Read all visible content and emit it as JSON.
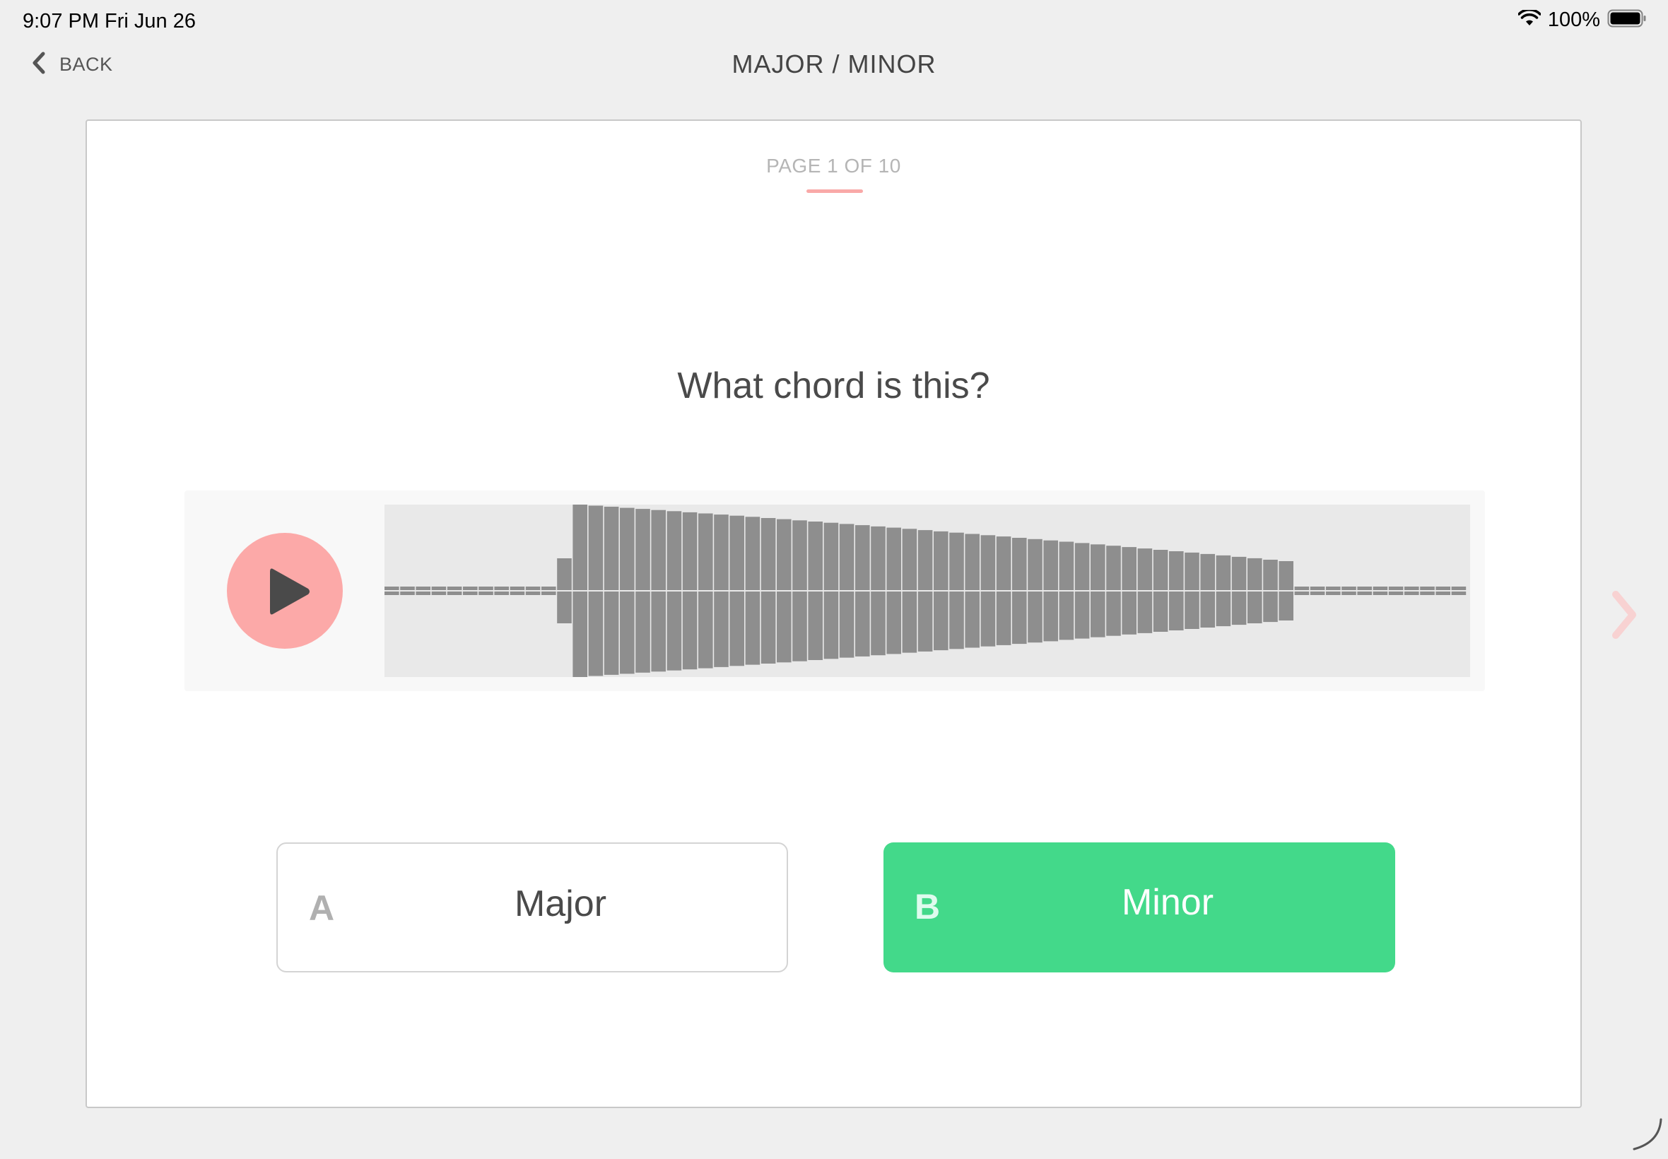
{
  "status_bar": {
    "time": "9:07 PM   Fri Jun 26",
    "battery_percent": "100%"
  },
  "nav": {
    "back_label": "BACK",
    "title": "MAJOR / MINOR"
  },
  "card": {
    "page_indicator": "PAGE 1 OF 10",
    "question": "What chord is this?"
  },
  "answers": [
    {
      "letter": "A",
      "label": "Major",
      "selected": false
    },
    {
      "letter": "B",
      "label": "Minor",
      "selected": true
    }
  ],
  "colors": {
    "accent_pink": "#fca9a8",
    "selected_green": "#43d98a",
    "waveform_bar": "#8e8e8e"
  },
  "icons": {
    "back": "chevron-left-icon",
    "play": "play-icon",
    "next": "chevron-right-icon",
    "wifi": "wifi-icon",
    "battery": "battery-icon"
  }
}
